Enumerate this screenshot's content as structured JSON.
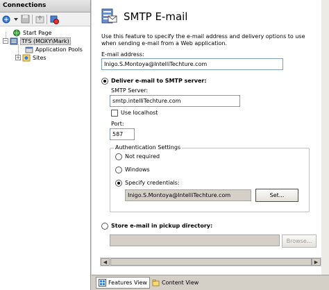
{
  "connections": {
    "title": "Connections",
    "tree": [
      {
        "label": "Start Page",
        "icon": "start-page-icon"
      },
      {
        "label": "TFS (MOXY\\Mark)",
        "icon": "server-icon"
      },
      {
        "label": "Application Pools",
        "icon": "app-pools-icon"
      },
      {
        "label": "Sites",
        "icon": "sites-icon"
      }
    ]
  },
  "feature": {
    "title": "SMTP E-mail",
    "description": "Use this feature to specify the e-mail address and delivery options to use when sending e-mail from a Web application.",
    "email_label": "E-mail address:",
    "email_value": "Inigo.S.Montoya@IntelliTechture.com",
    "deliver_smtp_label": "Deliver e-mail to SMTP server:",
    "smtp_server_label": "SMTP Server:",
    "smtp_server_value": "smtp.intelliTechture.com",
    "use_localhost_label": "Use localhost",
    "port_label": "Port:",
    "port_value": "587",
    "auth_group_title": "Authentication Settings",
    "auth_not_required": "Not required",
    "auth_windows": "Windows",
    "auth_specify": "Specify credentials:",
    "credentials_value": "Inigo.S.Montoya@IntelliTechture.com",
    "set_button": "Set...",
    "pickup_label": "Store e-mail in pickup directory:",
    "pickup_value": "",
    "browse_button": "Browse..."
  },
  "bottom_tabs": {
    "features_view": "Features View",
    "content_view": "Content View"
  },
  "colors": {
    "accent_blue": "#2a62c9",
    "panel_gray": "#d4d0c8",
    "input_border": "#7f9db9"
  }
}
